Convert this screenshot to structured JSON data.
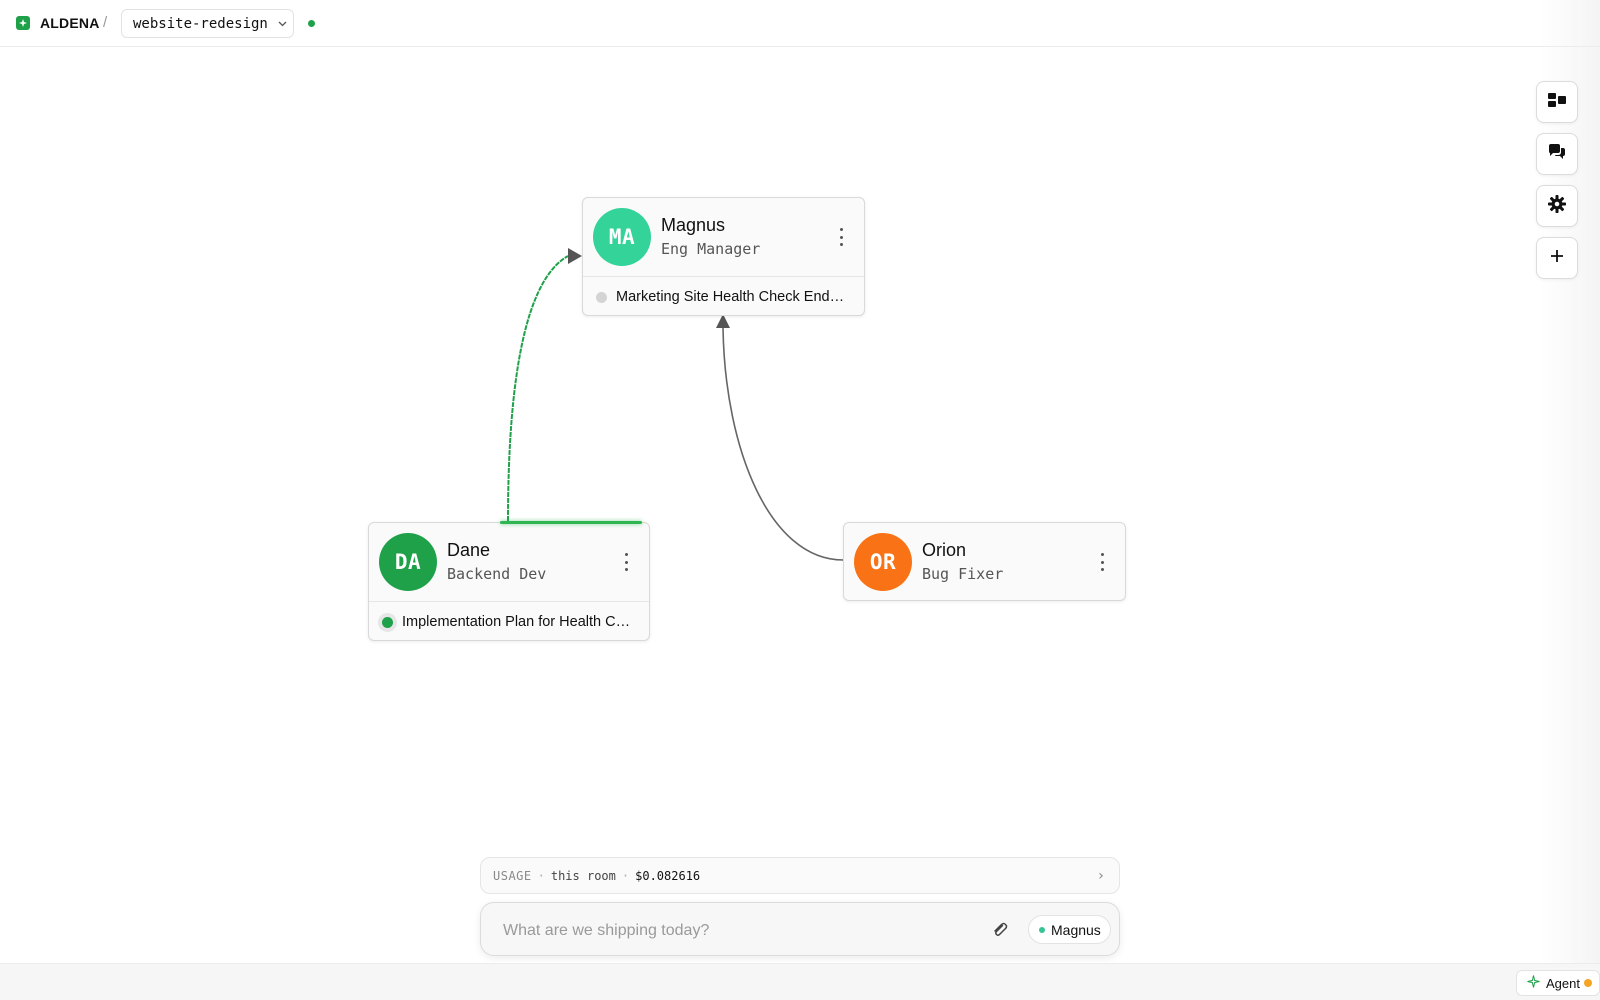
{
  "app": {
    "brand": "ALDENA",
    "separator": "/",
    "project": "website-redesign",
    "status_color": "#1fa14a"
  },
  "rail": {
    "buttons": [
      {
        "name": "layout-toggle-button",
        "icon": "dashboard-layout-icon"
      },
      {
        "name": "chat-button",
        "icon": "chat-bubbles-icon"
      },
      {
        "name": "settings-button",
        "icon": "gear-icon"
      },
      {
        "name": "add-agent-button",
        "icon": "plus-icon"
      }
    ]
  },
  "nodes": {
    "magnus": {
      "initials": "MA",
      "name": "Magnus",
      "role": "Eng Manager",
      "avatar_color": "#34d399",
      "task": "Marketing Site Health Check Endpoint",
      "task_status": "idle",
      "task_dot_color": "#d4d4d4"
    },
    "dane": {
      "initials": "DA",
      "name": "Dane",
      "role": "Backend Dev",
      "avatar_color": "#1fa14a",
      "task": "Implementation Plan for Health Check Endpoint",
      "task_status": "active",
      "task_dot_color": "#1fa14a"
    },
    "orion": {
      "initials": "OR",
      "name": "Orion",
      "role": "Bug Fixer",
      "avatar_color": "#f97316"
    }
  },
  "edges": [
    {
      "from": "Dane",
      "to": "Magnus",
      "style": "active",
      "color": "#1fa14a"
    },
    {
      "from": "Orion",
      "to": "Magnus",
      "style": "idle",
      "color": "#666666"
    }
  ],
  "usage": {
    "label": "USAGE",
    "dot": "·",
    "scope": "this room",
    "cost": "$0.082616"
  },
  "composer": {
    "placeholder": "What are we shipping today?",
    "agent": "Magnus",
    "attach_icon": "paperclip-icon"
  },
  "footer": {
    "agent_label": "Agent",
    "agent_icon": "sparkle-icon",
    "notification_color": "#f5a524"
  }
}
